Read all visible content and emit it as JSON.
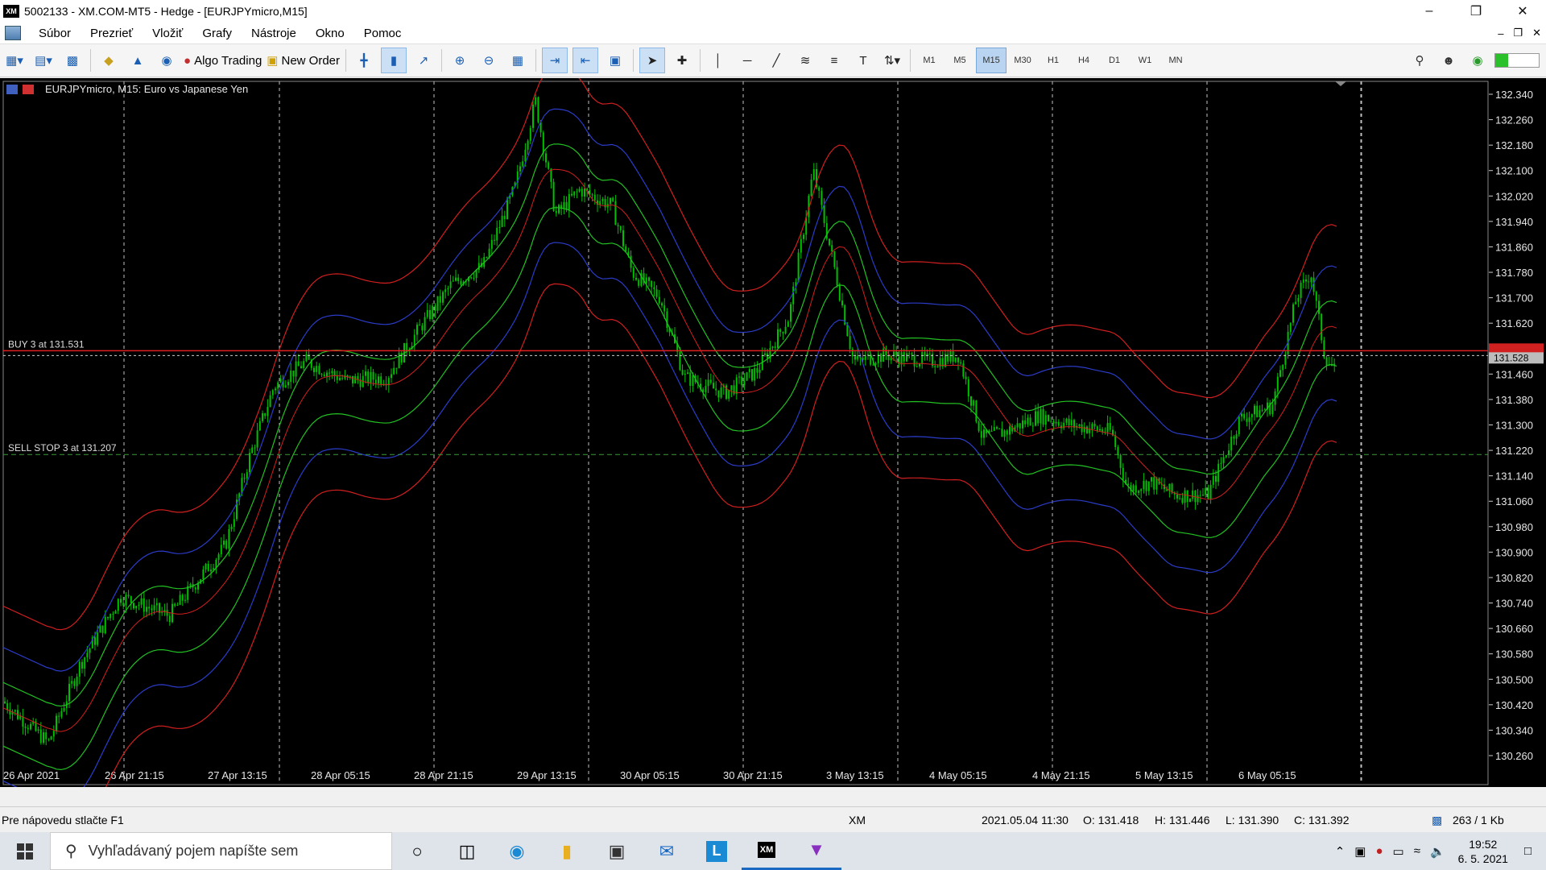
{
  "window": {
    "title": "5002133 - XM.COM-MT5 - Hedge - [EURJPYmicro,M15]",
    "logo": "XM"
  },
  "menu": [
    "Súbor",
    "Prezrieť",
    "Vložiť",
    "Grafy",
    "Nástroje",
    "Okno",
    "Pomoc"
  ],
  "toolbar": {
    "algo": "Algo Trading",
    "new_order": "New Order"
  },
  "timeframes": [
    "M1",
    "M5",
    "M15",
    "M30",
    "H1",
    "H4",
    "D1",
    "W1",
    "MN"
  ],
  "active_timeframe": "M15",
  "chart": {
    "symbol_label": "EURJPYmicro, M15:  Euro vs Japanese Yen",
    "price_ticks": [
      "132.340",
      "132.260",
      "132.180",
      "132.100",
      "132.020",
      "131.940",
      "131.860",
      "131.780",
      "131.700",
      "131.620",
      "131.540",
      "131.460",
      "131.380",
      "131.300",
      "131.220",
      "131.140",
      "131.060",
      "130.980",
      "130.900",
      "130.820",
      "130.740",
      "130.660",
      "130.580",
      "130.500",
      "130.420",
      "130.340",
      "130.260"
    ],
    "time_ticks": [
      "26 Apr 2021",
      "26 Apr 21:15",
      "27 Apr 13:15",
      "28 Apr 05:15",
      "28 Apr 21:15",
      "29 Apr 13:15",
      "30 Apr 05:15",
      "30 Apr 21:15",
      "3 May 13:15",
      "4 May 05:15",
      "4 May 21:15",
      "5 May 13:15",
      "6 May 05:15"
    ],
    "current_price": "131.528",
    "ask_price": "131.531",
    "buy_label": "BUY 3 at 131.531",
    "sell_label": "SELL STOP 3 at 131.207",
    "buy_price": 131.531,
    "sell_price": 131.207,
    "price_min": 130.26,
    "price_max": 132.34,
    "colors": {
      "background": "#000000",
      "candle": "#00c000",
      "grid": "#bfbfbf",
      "band_red": "#d11f1f",
      "band_blue": "#2b3cc8",
      "band_green": "#22c022",
      "buy_line": "#e02020",
      "sell_line": "#3a9a3a"
    }
  },
  "status": {
    "help": "Pre nápovedu stlačte F1",
    "profile": "XM",
    "datetime": "2021.05.04 11:30",
    "open": "O: 131.418",
    "high": "H: 131.446",
    "low": "L: 131.390",
    "close": "C: 131.392",
    "traffic": "263 / 1 Kb"
  },
  "taskbar": {
    "search_placeholder": "Vyhľadávaný pojem napíšte sem",
    "time": "19:52",
    "date": "6. 5. 2021"
  }
}
